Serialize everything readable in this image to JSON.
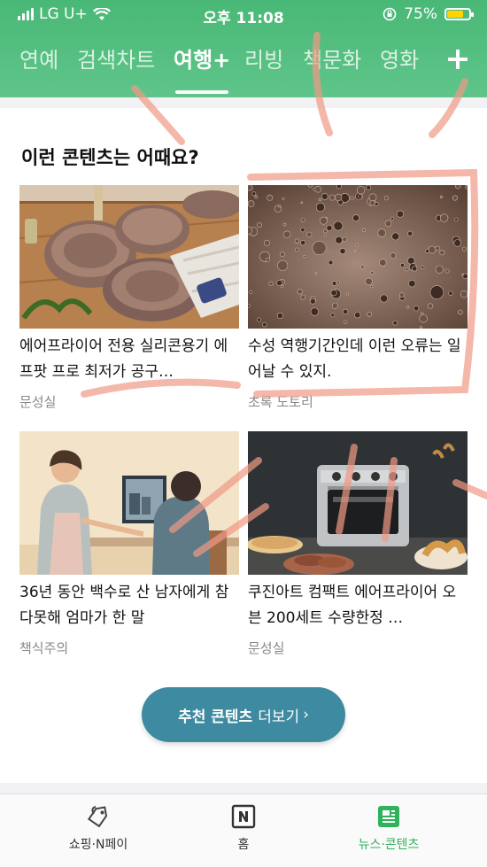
{
  "status": {
    "carrier": "LG U+",
    "time": "오후 11:08",
    "battery": "75%",
    "battery_level": 0.75
  },
  "tabs": [
    {
      "label": "연예"
    },
    {
      "label": "검색차트"
    },
    {
      "label": "여행+",
      "active": true
    },
    {
      "label": "리빙"
    },
    {
      "label": "책문화"
    },
    {
      "label": "영화"
    }
  ],
  "section": {
    "title": "이런 콘텐츠는 어때요?"
  },
  "items": [
    {
      "title": "에어프라이어 전용 실리콘용기 에프팟 프로 최저가 공구…",
      "source": "문성실",
      "image": "silicone-airfryer-bowls"
    },
    {
      "title": "수성 역행기간인데 이런 오류는 일어날 수 있지.",
      "source": "초록 도토리",
      "image": "coffee-foam-bubbles"
    },
    {
      "title": "36년 동안 백수로 산 남자에게 참다못해 엄마가 한 말",
      "source": "책식주의",
      "image": "illustration-mother-son"
    },
    {
      "title": "쿠진아트 컴팩트 에어프라이어 오븐 200세트 수량한정 …",
      "source": "문성실",
      "image": "airfryer-oven-cookies"
    }
  ],
  "more_button": {
    "bold": "추천 콘텐츠",
    "rest": "더보기",
    "chevron": "›"
  },
  "bottom_nav": [
    {
      "label": "쇼핑·N페이",
      "icon": "shopping-tag-icon"
    },
    {
      "label": "홈",
      "icon": "naver-n-icon"
    },
    {
      "label": "뉴스·콘텐츠",
      "icon": "news-content-icon",
      "active": true
    }
  ],
  "colors": {
    "header_green": "#4cbb7a",
    "accent_green": "#2fb25b",
    "button_teal": "#3e8aa0",
    "annotation_red": "#f09a86"
  }
}
